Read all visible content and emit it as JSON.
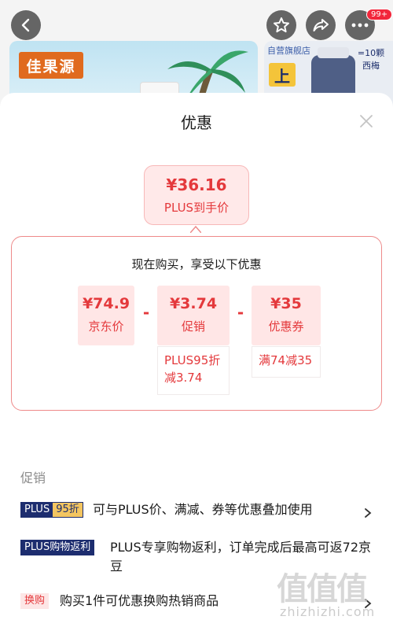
{
  "header": {
    "brand": "佳果源",
    "store_title": "自营旗舰店",
    "store_up": "上",
    "store_note": "=10颗 西梅",
    "notification_count": "99+"
  },
  "sheet": {
    "title": "优惠",
    "final_price": "¥36.16",
    "final_label": "PLUS到手价",
    "calc_heading": "现在购买，享受以下优惠",
    "items": [
      {
        "value": "¥74.9",
        "label": "京东价"
      },
      {
        "value": "¥3.74",
        "label": "促销",
        "note": "PLUS95折减3.74"
      },
      {
        "value": "¥35",
        "label": "优惠券",
        "note": "满74减35"
      }
    ],
    "minus": "-"
  },
  "promotions": {
    "title": "促销",
    "rows": [
      {
        "tag_a": "PLUS",
        "tag_b": "95折",
        "text": "可与PLUS价、满减、券等优惠叠加使用"
      },
      {
        "tag": "PLUS购物返利",
        "text": "PLUS专享购物返利，订单完成后最高可返72京豆"
      },
      {
        "tag": "换购",
        "text": "购买1件可优惠换购热销商品"
      }
    ]
  },
  "watermark": {
    "glyphs": "值值值",
    "url": "zhizhizhi.com"
  },
  "colors": {
    "accent": "#e4393c",
    "plus_navy": "#1d2d6f",
    "plus_gold": "#f3c560"
  },
  "icons": [
    "back-arrow-icon",
    "star-icon",
    "share-icon",
    "more-icon",
    "close-icon",
    "chevron-right-icon"
  ]
}
